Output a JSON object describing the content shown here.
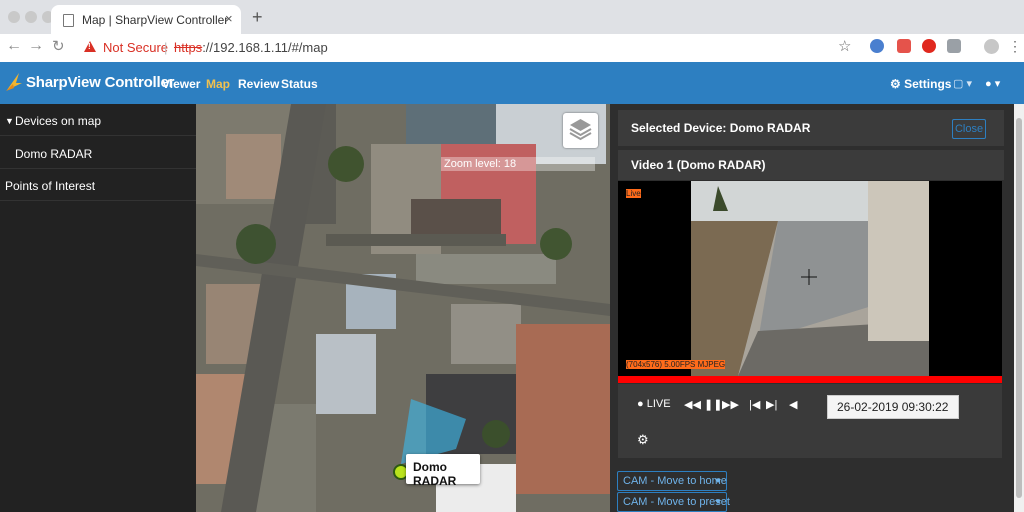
{
  "browser": {
    "tab_title": "Map | SharpView Controller",
    "tab_close": "×",
    "new_tab": "+",
    "security_label": "Not Secure",
    "url_protocol": "https",
    "url_rest": "://192.168.1.11/#/map"
  },
  "app": {
    "brand": "SharpView Controller",
    "nav": [
      "Viewer",
      "Map",
      "Review",
      "Status"
    ],
    "active_nav": "Map",
    "settings_label": "Settings"
  },
  "sidebar": {
    "section_label": "Devices on map",
    "device": "Domo RADAR",
    "poi_label": "Points of Interest"
  },
  "map": {
    "zoom_label": "Zoom level: 18",
    "marker_label": "Domo RADAR"
  },
  "panel": {
    "selected_title": "Selected Device: Domo RADAR",
    "close_label": "Close",
    "video_title": "Video 1 (Domo RADAR)",
    "live_overlay": "Live",
    "stream_info": "(704x576) 5.00FPS MJPEG",
    "live_label": "LIVE",
    "datetime": "26-02-2019 09:30:22",
    "cam_buttons": [
      "CAM - Move to home",
      "CAM - Move to preset"
    ]
  },
  "colors": {
    "appbar": "#2d7fc1",
    "active_nav": "#f2c14e",
    "alert_red": "#ff0000"
  }
}
